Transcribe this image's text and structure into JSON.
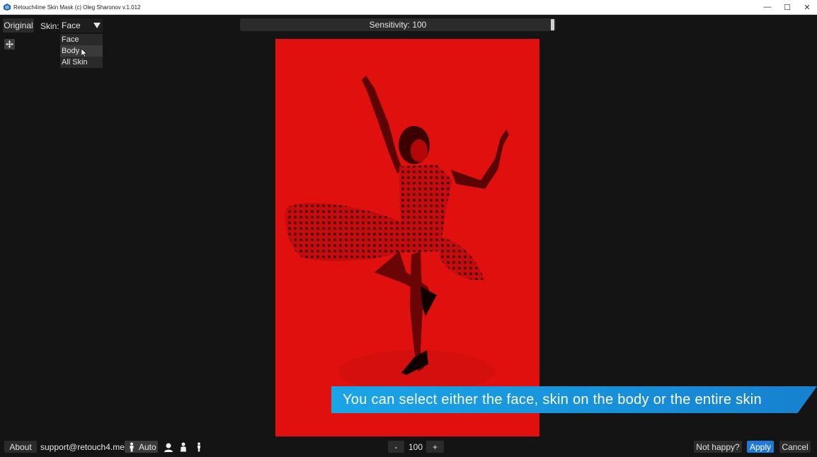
{
  "window": {
    "title": "Retouch4me Skin Mask (c) Oleg Sharonov v.1.012",
    "minimize": "—",
    "maximize": "☐",
    "close": "✕"
  },
  "toolbar": {
    "original_label": "Original",
    "skin_label": "Skin:",
    "skin_selected": "Face",
    "skin_options": [
      "Face",
      "Body",
      "All Skin"
    ],
    "hovered_option": "Body"
  },
  "slider": {
    "label": "Sensitivity: 100",
    "value": 100
  },
  "caption": {
    "text": "You can select either the face, skin on the body or the entire skin"
  },
  "bottom": {
    "about_label": "About",
    "email": "support@retouch4.me",
    "auto_label": "Auto",
    "zoom_minus": "-",
    "zoom_value": "100",
    "zoom_plus": "+",
    "not_happy_label": "Not happy?",
    "apply_label": "Apply",
    "cancel_label": "Cancel"
  },
  "colors": {
    "background": "#141414",
    "photo_mask": "#e0100f",
    "accent": "#1f79d6",
    "caption": "#1aa5e6"
  }
}
